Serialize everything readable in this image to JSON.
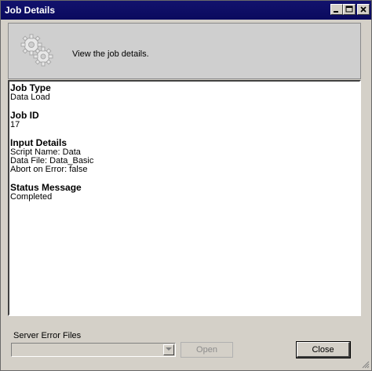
{
  "window": {
    "title": "Job Details"
  },
  "header": {
    "icon": "gears-icon",
    "text": "View the job details."
  },
  "details": {
    "sections": [
      {
        "heading": "Job Type",
        "lines": [
          "Data Load"
        ]
      },
      {
        "heading": "Job ID",
        "lines": [
          "17"
        ]
      },
      {
        "heading": "Input Details",
        "lines": [
          "Script Name:  Data",
          "Data File:  Data_Basic",
          "Abort on Error:  false"
        ]
      },
      {
        "heading": "Status Message",
        "lines": [
          "Completed"
        ]
      }
    ]
  },
  "bottom": {
    "server_error_files_label": "Server Error Files",
    "combo_value": "",
    "open_label": "Open",
    "close_label": "Close"
  },
  "colors": {
    "title_bar": "#0a0a5e",
    "window_bg": "#d4d0c8",
    "header_bg": "#cfcfcf"
  }
}
